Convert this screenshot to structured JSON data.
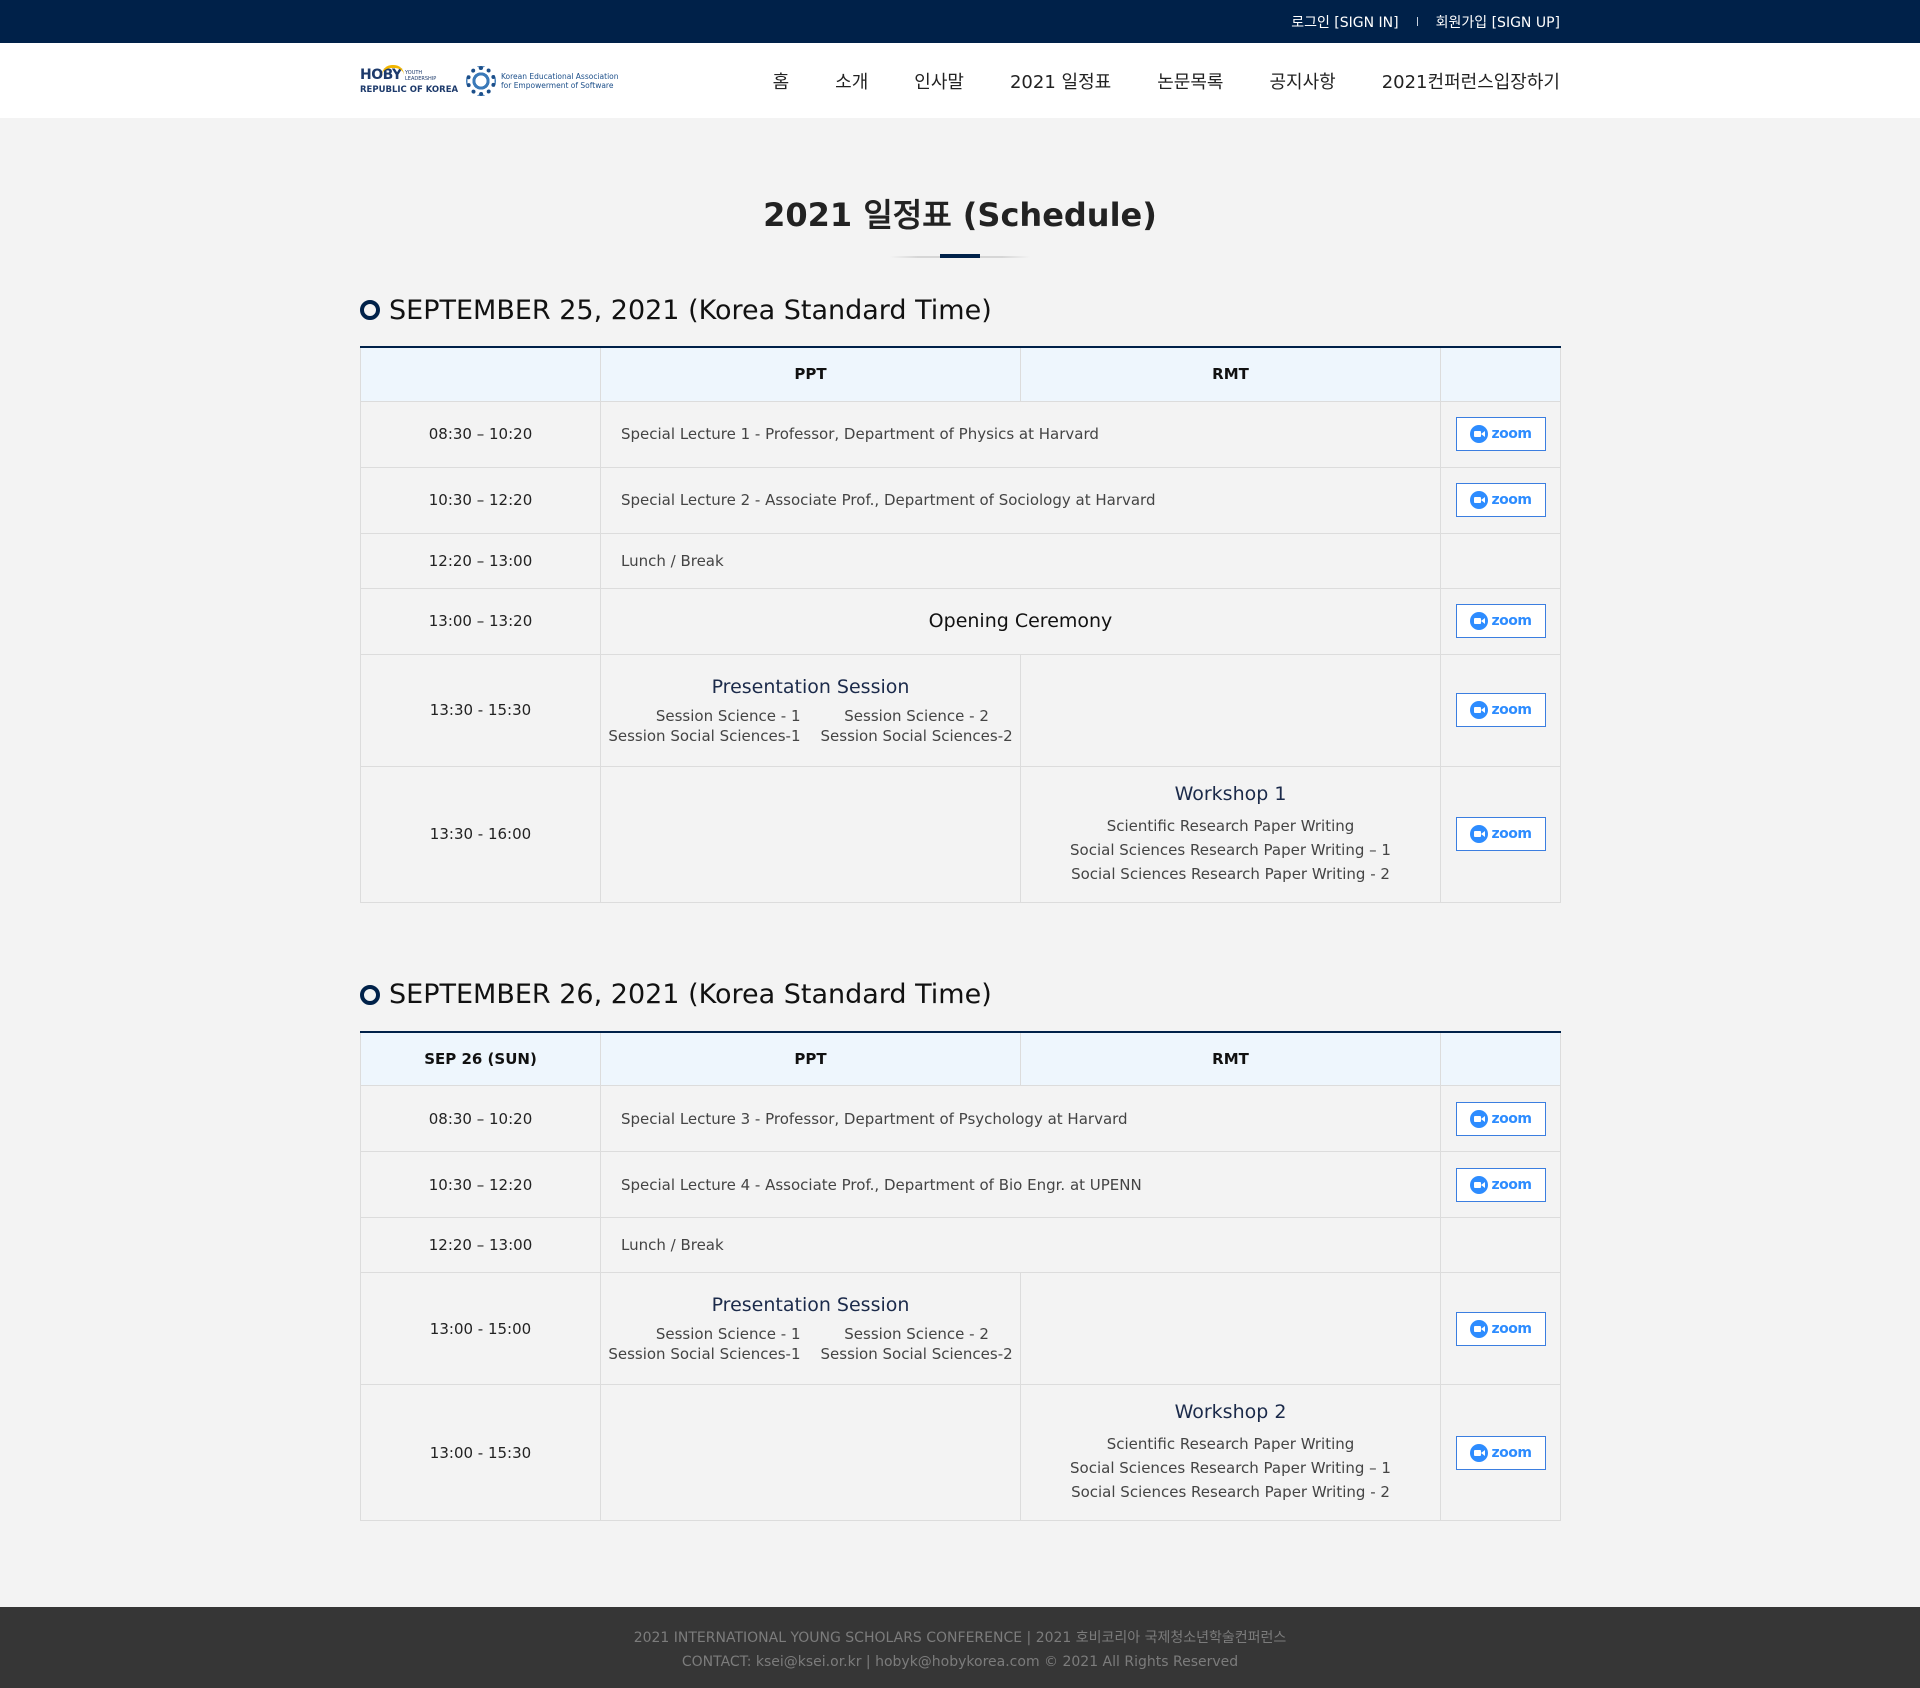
{
  "topbar": {
    "signin": "로그인 [SIGN IN]",
    "signup": "회원가입 [SIGN UP]"
  },
  "header": {
    "hoby_logo": {
      "word": "HOBY",
      "sub": "YOUTH LEADERSHIP",
      "country": "REPUBLIC OF KOREA"
    },
    "ksei_logo": {
      "line1": "Korean Educational Association",
      "line2": "for Empowerment of Software"
    },
    "nav": [
      "홈",
      "소개",
      "인사말",
      "2021 일정표",
      "논문목록",
      "공지사항",
      "2021컨퍼런스입장하기"
    ]
  },
  "page_title": "2021 일정표 (Schedule)",
  "zoom_label": "zoom",
  "days": [
    {
      "heading": "SEPTEMBER 25, 2021 (Korea Standard Time)",
      "columns": [
        "",
        "PPT",
        "RMT",
        ""
      ],
      "rows": {
        "r1": {
          "time": "08:30 – 10:20",
          "desc": "Special Lecture 1 - Professor, Department of Physics at Harvard"
        },
        "r2": {
          "time": "10:30 – 12:20",
          "desc": "Special Lecture 2 - Associate Prof., Department of Sociology at Harvard"
        },
        "r3": {
          "time": "12:20 – 13:00",
          "desc": "Lunch / Break"
        },
        "r4": {
          "time": "13:00 – 13:20",
          "desc": "Opening Ceremony"
        },
        "r5": {
          "time": "13:30 - 15:30",
          "title": "Presentation Session",
          "items": [
            "Session Science - 1",
            "Session Science - 2",
            "Session Social Sciences-1",
            "Session Social Sciences-2"
          ]
        },
        "r6": {
          "time": "13:30 - 16:00",
          "title": "Workshop 1",
          "items": [
            "Scientific Research Paper Writing",
            "Social Sciences Research Paper Writing – 1",
            "Social Sciences Research Paper Writing - 2"
          ]
        }
      }
    },
    {
      "heading": "SEPTEMBER 26, 2021 (Korea Standard Time)",
      "columns": [
        "SEP 26 (SUN)",
        "PPT",
        "RMT",
        ""
      ],
      "rows": {
        "r1": {
          "time": "08:30 – 10:20",
          "desc": "Special Lecture 3 - Professor, Department of Psychology at Harvard"
        },
        "r2": {
          "time": "10:30 – 12:20",
          "desc": "Special Lecture 4 - Associate Prof., Department of Bio Engr. at UPENN"
        },
        "r3": {
          "time": "12:20 – 13:00",
          "desc": "Lunch / Break"
        },
        "r4": {
          "time": "13:00 - 15:00",
          "title": "Presentation Session",
          "items": [
            "Session Science - 1",
            "Session Science - 2",
            "Session Social Sciences-1",
            "Session Social Sciences-2"
          ]
        },
        "r5": {
          "time": "13:00 - 15:30",
          "title": "Workshop 2",
          "items": [
            "Scientific Research Paper Writing",
            "Social Sciences Research Paper Writing – 1",
            "Social Sciences Research Paper Writing - 2"
          ]
        }
      }
    }
  ],
  "footer": {
    "line1": "2021 INTERNATIONAL YOUNG SCHOLARS CONFERENCE | 2021 호비코리아 국제청소년학술컨퍼런스",
    "line2": "CONTACT: ksei@ksei.or.kr | hobyk@hobykorea.com © 2021 All Rights Reserved"
  },
  "colors": {
    "navy": "#002149",
    "zoom_blue": "#2d8cff",
    "header_cell": "#eef6fd",
    "footer": "#363636"
  }
}
